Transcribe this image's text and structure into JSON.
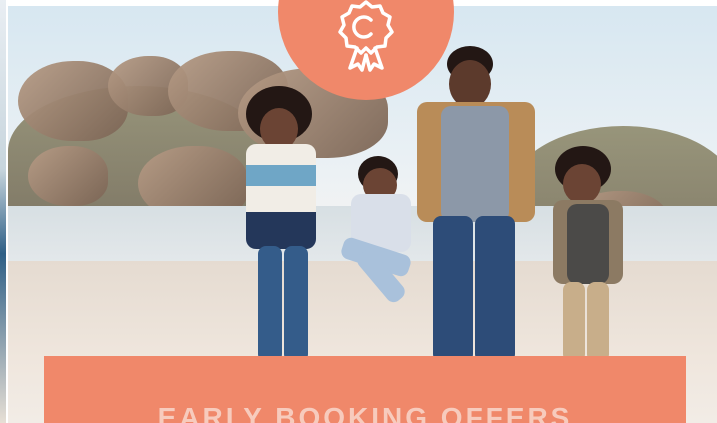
{
  "hero": {
    "image_alt": "Family running and playing on a sunny beach"
  },
  "badge": {
    "icon": "rosette-award-icon",
    "color": "#f0886a"
  },
  "banner": {
    "title": "EARLY BOOKING OFFERS",
    "color": "#f0886a"
  }
}
